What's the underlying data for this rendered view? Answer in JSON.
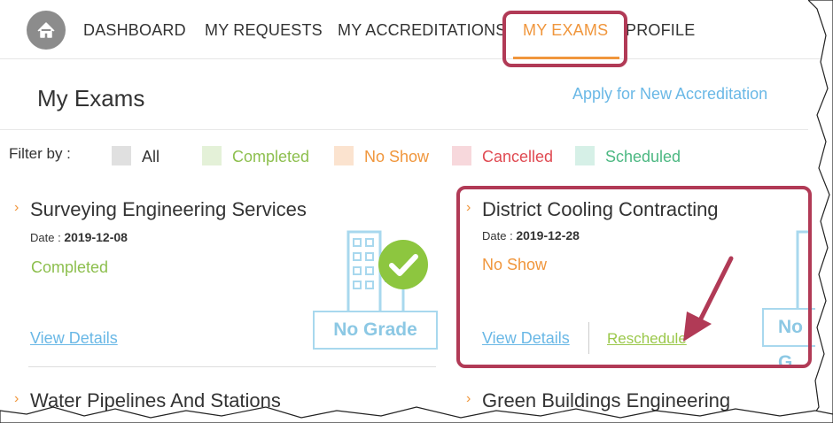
{
  "nav": {
    "items": [
      {
        "label": "DASHBOARD"
      },
      {
        "label": "MY REQUESTS"
      },
      {
        "label": "MY ACCREDITATIONS"
      },
      {
        "label": "MY EXAMS"
      },
      {
        "label": "PROFILE"
      }
    ],
    "active": "MY EXAMS"
  },
  "page": {
    "title": "My Exams",
    "apply_link": "Apply for New Accreditation"
  },
  "filters": {
    "label": "Filter by :",
    "options": [
      {
        "label": "All",
        "color": "#e0e0e0",
        "text_color": "#333333"
      },
      {
        "label": "Completed",
        "color": "#e4f1d8",
        "text_color": "#8dbf4e"
      },
      {
        "label": "No Show",
        "color": "#fbe3cf",
        "text_color": "#f0963c"
      },
      {
        "label": "Cancelled",
        "color": "#f7d8dc",
        "text_color": "#e04a52"
      },
      {
        "label": "Scheduled",
        "color": "#d6f0e7",
        "text_color": "#4cb882"
      }
    ]
  },
  "cards": [
    {
      "title": "Surveying Engineering Services",
      "date_label": "Date :",
      "date": "2019-12-08",
      "status": "Completed",
      "status_color": "#8dbf4e",
      "badge": "No Grade",
      "view_details": "View Details"
    },
    {
      "title": "District Cooling Contracting",
      "date_label": "Date :",
      "date": "2019-12-28",
      "status": "No Show",
      "status_color": "#f0963c",
      "badge": "No G",
      "view_details": "View Details",
      "reschedule": "Reschedule"
    },
    {
      "title": "Water Pipelines And Stations"
    },
    {
      "title": "Green Buildings Engineering"
    }
  ],
  "colors": {
    "accent": "#f0963c",
    "link": "#6ab8e6",
    "highlight": "#b13a56"
  }
}
